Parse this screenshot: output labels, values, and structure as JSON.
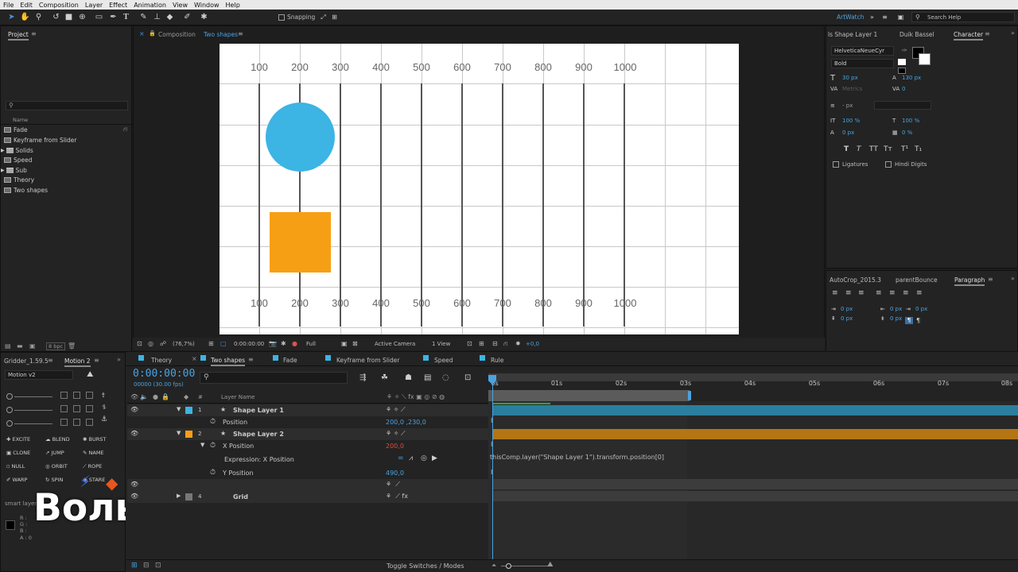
{
  "menu": [
    "File",
    "Edit",
    "Composition",
    "Layer",
    "Effect",
    "Animation",
    "View",
    "Window",
    "Help"
  ],
  "toolbar": {
    "snapping_label": "Snapping",
    "workspace": "ArtWatch",
    "search_placeholder": "Search Help"
  },
  "project": {
    "title": "Project",
    "column_name": "Name",
    "items": [
      {
        "name": "Fade",
        "kind": "comp"
      },
      {
        "name": "Keyframe from Slider",
        "kind": "comp"
      },
      {
        "name": "Solids",
        "kind": "folder"
      },
      {
        "name": "Speed",
        "kind": "comp"
      },
      {
        "name": "Sub",
        "kind": "folder"
      },
      {
        "name": "Theory",
        "kind": "comp"
      },
      {
        "name": "Two shapes",
        "kind": "comp"
      }
    ],
    "bpc": "8 bpc"
  },
  "composition": {
    "panel_label": "Composition",
    "name": "Two shapes",
    "ruler_labels": [
      "100",
      "200",
      "300",
      "400",
      "500",
      "600",
      "700",
      "800",
      "900",
      "1000"
    ],
    "footer": {
      "zoom": "(76,7%)",
      "time": "0:00:00:00",
      "resolution": "Full",
      "camera": "Active Camera",
      "view": "1 View",
      "exposure": "+0,0"
    },
    "colors": {
      "circle": "#3cb4e4",
      "square": "#f79f14"
    }
  },
  "right_panel": {
    "tabs_top": [
      "ls Shape Layer 1",
      "Duik Bassel",
      "Character"
    ],
    "font_family": "HelveticaNeueCyr",
    "font_style": "Bold",
    "font_size": "30 px",
    "leading": "130 px",
    "kerning": "Metrics",
    "tracking": "0",
    "stroke": "- px",
    "vscale": "100 %",
    "hscale": "100 %",
    "baseline": "0 px",
    "tsume": "0 %",
    "type_styles": [
      "T",
      "T",
      "TT",
      "Tт",
      "T¹",
      "T₁"
    ],
    "ligatures": "Ligatures",
    "hindi": "Hindi Digits",
    "tabs_bottom": [
      "AutoCrop_2015.3",
      "parentBounce",
      "Paragraph"
    ],
    "para_values": [
      "0 px",
      "0 px",
      "0 px",
      "0 px",
      "0 px"
    ]
  },
  "motion": {
    "tabs": [
      "Gridder_1.59.5",
      "Motion 2"
    ],
    "version": "Motion v2",
    "buttons": [
      "EXCITE",
      "BLEND",
      "BURST",
      "CLONE",
      "JUMP",
      "NAME",
      "NULL",
      "ORBIT",
      "ROPE",
      "WARP",
      "SPIN",
      "STARE"
    ],
    "smart_layers": "smart layers",
    "rgba": [
      "R :",
      "G :",
      "B :",
      "A : 0"
    ]
  },
  "watermark": "Вольница",
  "timeline": {
    "tabs": [
      "Theory",
      "Two shapes",
      "Fade",
      "Keyframe from Slider",
      "Speed",
      "Rule"
    ],
    "active_tab": "Two shapes",
    "timecode": "0:00:00:00",
    "frames": "00000 (30.00 fps)",
    "col_layer_name": "Layer Name",
    "time_marks": [
      "0s",
      "01s",
      "02s",
      "03s",
      "04s",
      "05s",
      "06s",
      "07s",
      "08s"
    ],
    "layers": [
      {
        "num": "1",
        "name": "Shape Layer 1",
        "color": "#3cb4e4"
      },
      {
        "num": "2",
        "name": "Shape Layer 2",
        "color": "#f79f14"
      },
      {
        "num": "4",
        "name": "Grid",
        "color": "#777777"
      }
    ],
    "position_label": "Position",
    "position_value": "200,0 ,230,0",
    "x_position_label": "X Position",
    "x_position_value": "200,0",
    "expression_label": "Expression: X Position",
    "expression_text": "thisComp.layer(\"Shape Layer 1\").transform.position[0]",
    "y_position_label": "Y Position",
    "y_position_value": "490,0",
    "footer_toggle": "Toggle Switches / Modes"
  }
}
